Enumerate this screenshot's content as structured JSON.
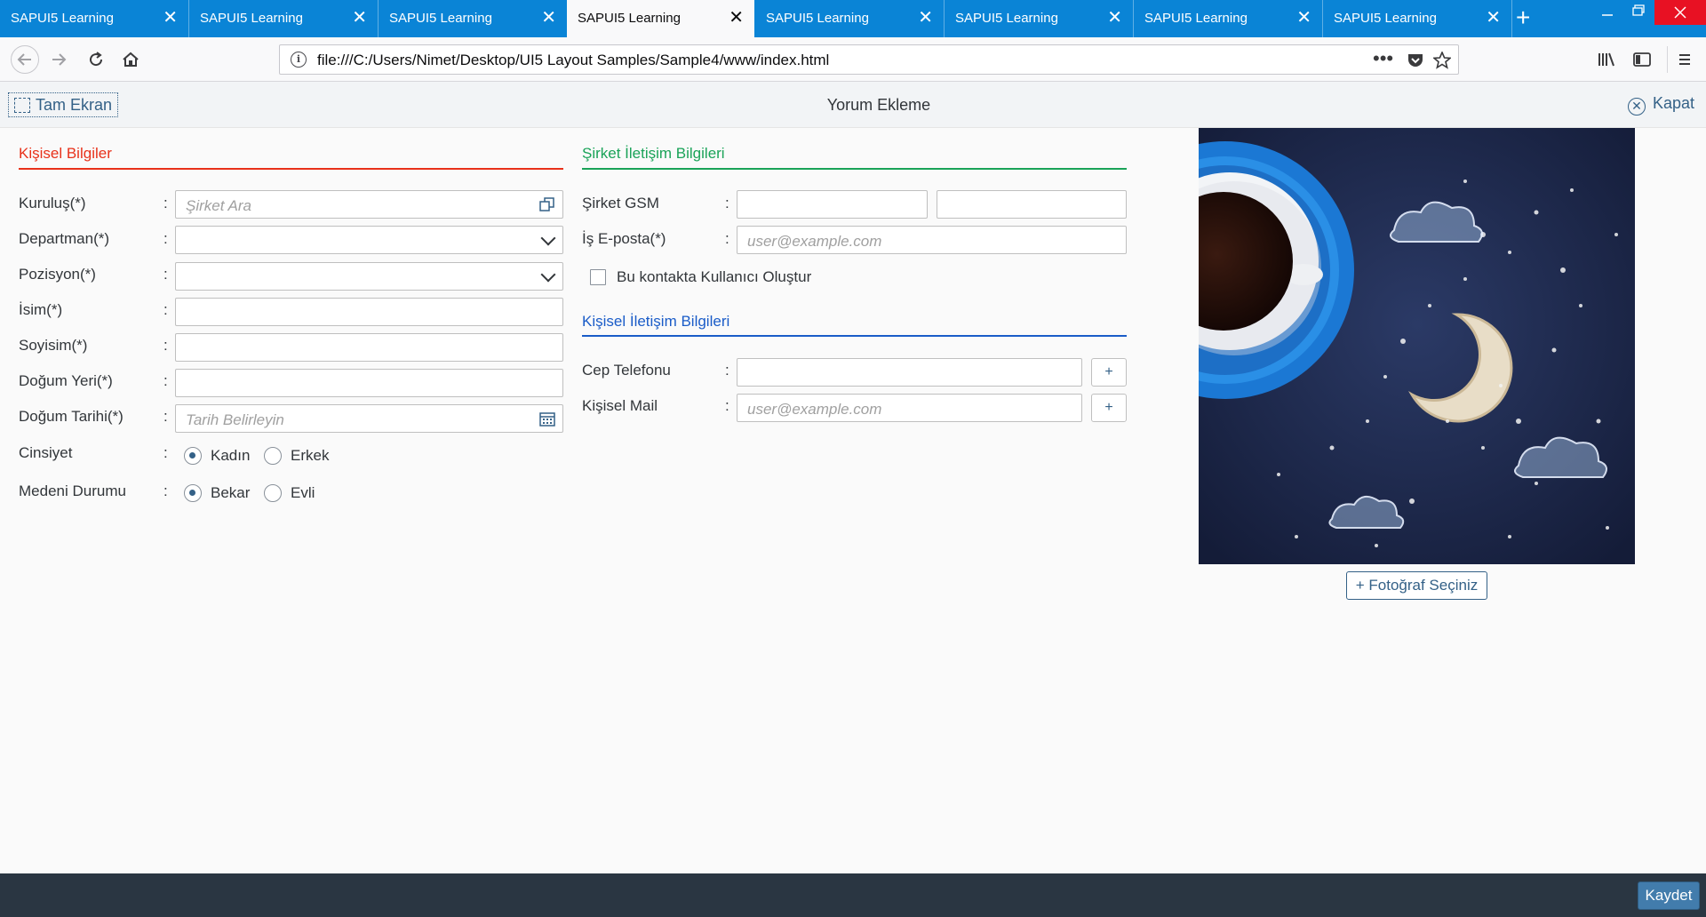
{
  "browser": {
    "tabs": [
      {
        "label": "SAPUI5 Learning",
        "active": false
      },
      {
        "label": "SAPUI5 Learning",
        "active": false
      },
      {
        "label": "SAPUI5 Learning",
        "active": false
      },
      {
        "label": "SAPUI5 Learning",
        "active": true
      },
      {
        "label": "SAPUI5 Learning",
        "active": false
      },
      {
        "label": "SAPUI5 Learning",
        "active": false
      },
      {
        "label": "SAPUI5 Learning",
        "active": false
      },
      {
        "label": "SAPUI5 Learning",
        "active": false
      }
    ],
    "close_glyph": "✕",
    "new_tab_glyph": "+",
    "url": "file:///C:/Users/Nimet/Desktop/UI5 Layout Samples/Sample4/www/index.html",
    "accent_color": "#0a84d6"
  },
  "app": {
    "fullscreen_label": "Tam Ekran",
    "title": "Yorum Ekleme",
    "close_label": "Kapat"
  },
  "personal": {
    "title": "Kişisel Bilgiler",
    "title_color": "#e8311a",
    "fields": {
      "kurulus": {
        "label": "Kuruluş(*)",
        "placeholder": "Şirket Ara"
      },
      "departman": {
        "label": "Departman(*)"
      },
      "pozisyon": {
        "label": "Pozisyon(*)"
      },
      "isim": {
        "label": "İsim(*)"
      },
      "soyisim": {
        "label": "Soyisim(*)"
      },
      "dogum_yeri": {
        "label": "Doğum Yeri(*)"
      },
      "dogum_tarihi": {
        "label": "Doğum Tarihi(*)",
        "placeholder": "Tarih Belirleyin"
      }
    },
    "gender": {
      "label": "Cinsiyet",
      "options": [
        "Kadın",
        "Erkek"
      ],
      "selected": "Kadın"
    },
    "marital": {
      "label": "Medeni Durumu",
      "options": [
        "Bekar",
        "Evli"
      ],
      "selected": "Bekar"
    }
  },
  "company_contact": {
    "title": "Şirket İletişim Bilgileri",
    "title_color": "#1aa358",
    "gsm_label": "Şirket GSM",
    "email_label": "İş E-posta(*)",
    "email_placeholder": "user@example.com",
    "create_user_label": "Bu kontakta Kullanıcı Oluştur",
    "create_user_checked": false
  },
  "personal_contact": {
    "title": "Kişisel İletişim Bilgileri",
    "title_color": "#1a5cc8",
    "phone_label": "Cep Telefonu",
    "mail_label": "Kişisel Mail",
    "mail_placeholder": "user@example.com",
    "add_glyph": "+"
  },
  "photo": {
    "button_label": "+ Fotoğraf Seçiniz"
  },
  "footer": {
    "save_label": "Kaydet"
  },
  "colon": ":"
}
